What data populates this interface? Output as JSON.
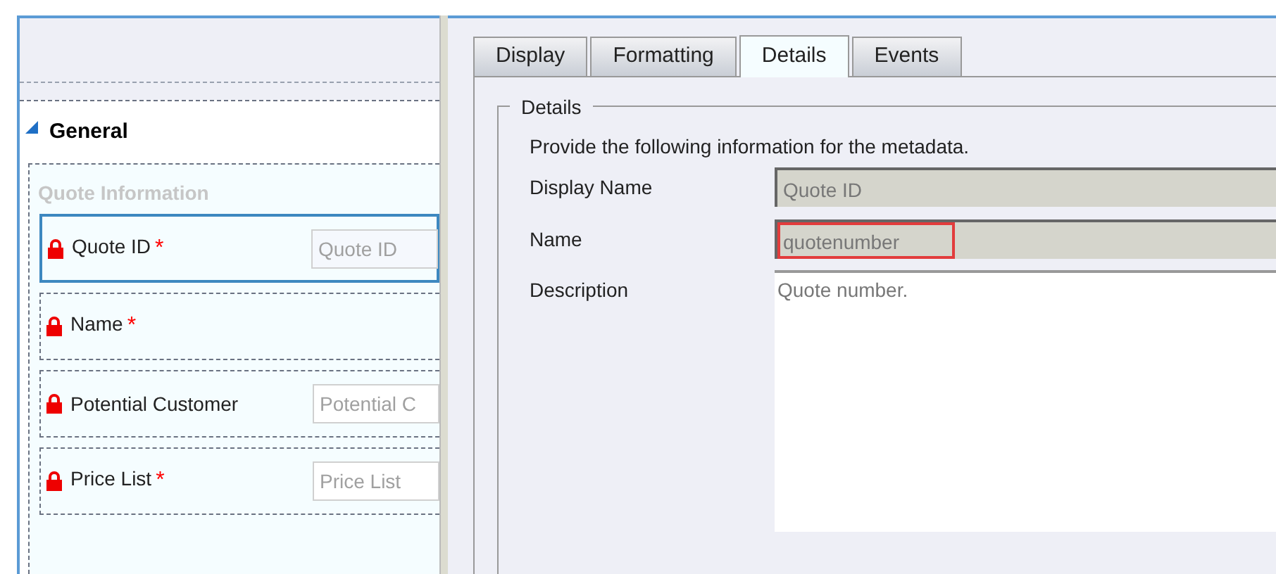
{
  "form": {
    "section": {
      "title": "General",
      "expanded": true
    },
    "group": {
      "title": "Quote Information"
    },
    "fields": [
      {
        "label": "Quote ID",
        "required_mark": "*",
        "locked": true,
        "placeholder": "Quote ID",
        "selected": true
      },
      {
        "label": "Name",
        "required_mark": "*",
        "locked": true,
        "selected": false
      },
      {
        "label": "Potential Customer",
        "locked": true,
        "placeholder": "Potential C",
        "selected": false
      },
      {
        "label": "Price List",
        "required_mark": "*",
        "locked": true,
        "placeholder": "Price List",
        "selected": false
      }
    ]
  },
  "properties": {
    "tabs": [
      {
        "label": "Display",
        "selected": false
      },
      {
        "label": "Formatting",
        "selected": false
      },
      {
        "label": "Details",
        "selected": true
      },
      {
        "label": "Events",
        "selected": false
      }
    ],
    "fieldset": {
      "legend": "Details",
      "intro": "Provide the following information for the metadata.",
      "rows": [
        {
          "kind": "readonly",
          "label": "Display Name",
          "value": "Quote ID",
          "highlighted": false
        },
        {
          "kind": "readonly",
          "label": "Name",
          "value": "quotenumber",
          "highlighted": true
        },
        {
          "kind": "textarea",
          "label": "Description",
          "value": "Quote number."
        }
      ]
    }
  }
}
